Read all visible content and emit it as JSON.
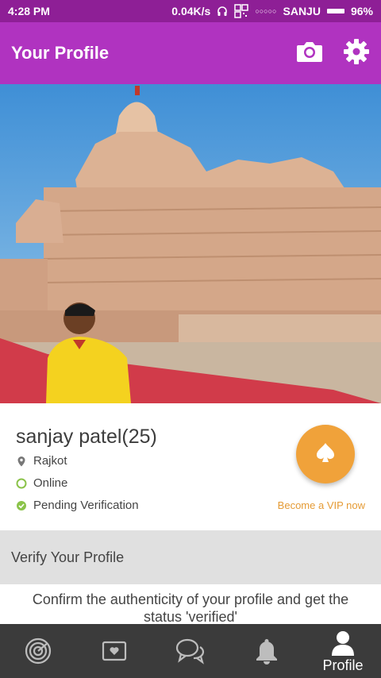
{
  "status_bar": {
    "time": "4:28 PM",
    "speed": "0.04K/s",
    "carrier": "SANJU",
    "battery": "96%"
  },
  "app_bar": {
    "title": "Your Profile",
    "icons": [
      "camera-icon",
      "settings-gear-icon"
    ]
  },
  "profile": {
    "name": "sanjay patel(25)",
    "location": "Rajkot",
    "status": "Online",
    "verification": "Pending Verification",
    "vip_label": "Become a VIP now"
  },
  "verify": {
    "title": "Verify Your Profile",
    "description": "Confirm the authenticity of your profile and get the status 'verified'"
  },
  "bottom_nav": {
    "items": [
      "radar-icon",
      "card-heart-icon",
      "chat-icon",
      "bell-icon",
      "profile-icon"
    ],
    "active_label": "Profile"
  },
  "colors": {
    "status_bar": "#8e1f96",
    "app_bar": "#b033c0",
    "vip": "#f0a23a",
    "online": "#8bc34a",
    "nav": "#3b3b3b"
  }
}
